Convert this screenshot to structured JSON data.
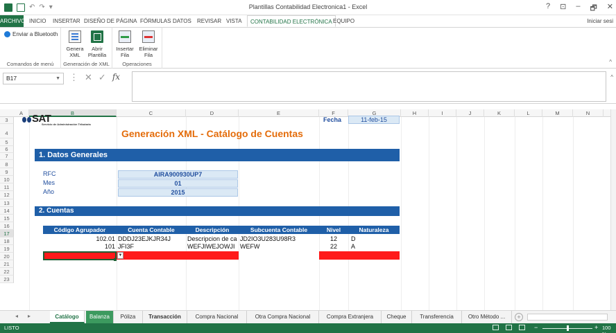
{
  "window": {
    "title": "Plantillas Contabilidad Electronica1 - Excel",
    "controls": [
      "?",
      "⊡",
      "–",
      "🗗",
      "✕"
    ]
  },
  "tabs": [
    "ARCHIVO",
    "INICIO",
    "INSERTAR",
    "DISEÑO DE PÁGINA",
    "FÓRMULAS",
    "DATOS",
    "REVISAR",
    "VISTA",
    "CONTABILIDAD ELECTRÓNICA",
    "EQUIPO"
  ],
  "active_tab": "CONTABILIDAD ELECTRÓNICA",
  "signin": "Iniciar sesi",
  "ribbon": {
    "groups": [
      {
        "label": "Comandos de menú",
        "buttons": [
          "Enviar a Bluetooth"
        ]
      },
      {
        "label": "Generación de XML",
        "buttons": [
          "Genera XML",
          "Abrir Plantilla"
        ]
      },
      {
        "label": "Operaciones",
        "buttons": [
          "Insertar Fila",
          "Eliminar Fila"
        ]
      }
    ],
    "genera_1": "Genera",
    "genera_2": "XML",
    "abrir_1": "Abrir",
    "abrir_2": "Plantilla",
    "insertar_1": "Insertar",
    "insertar_2": "Fila",
    "eliminar_1": "Eliminar",
    "eliminar_2": "Fila"
  },
  "formula_bar": {
    "name_box": "B17",
    "formula": ""
  },
  "columns": [
    "A",
    "B",
    "C",
    "D",
    "E",
    "F",
    "G",
    "H",
    "I",
    "J",
    "K",
    "L",
    "M",
    "N"
  ],
  "selected_column": "B",
  "rows": [
    "3",
    "4",
    "5",
    "6",
    "7",
    "8",
    "9",
    "10",
    "11",
    "12",
    "13",
    "14",
    "15",
    "16",
    "17",
    "18",
    "19",
    "20",
    "21",
    "22",
    "23"
  ],
  "selected_row": "17",
  "sheet": {
    "logo": "SAT",
    "logo_sub": "Servicio de Administración Tributaria",
    "fecha_label": "Fecha",
    "fecha_value": "11-feb-15",
    "title": "Generación XML - Catálogo de Cuentas",
    "section1": "1. Datos Generales",
    "general": [
      {
        "label": "RFC",
        "value": "AIRA900930UP7"
      },
      {
        "label": "Mes",
        "value": "01"
      },
      {
        "label": "Año",
        "value": "2015"
      }
    ],
    "section2": "2. Cuentas",
    "headers": [
      "Código Agrupador",
      "Cuenta Contable",
      "Descripción",
      "Subcuenta Contable",
      "Nivel",
      "Naturaleza"
    ],
    "rows": [
      {
        "codigo": "102.01",
        "cuenta": "DDDJ23EJKJR34J",
        "descripcion": "Descripcion de ca",
        "subcuenta": "JD2IO3U283U98R3",
        "nivel": "12",
        "naturaleza": "D"
      },
      {
        "codigo": "101",
        "cuenta": "JFI3F",
        "descripcion": "WEFJIWEJOWJI",
        "subcuenta": "WEFW",
        "nivel": "22",
        "naturaleza": "A"
      }
    ]
  },
  "sheet_tabs": [
    "Catálogo",
    "Balanza",
    "Póliza",
    "Transacción",
    "Compra Nacional",
    "Otra Compra Nacional",
    "Compra Extranjera",
    "Cheque",
    "Transferencia",
    "Otro Método ..."
  ],
  "active_sheet": "Catálogo",
  "status": {
    "text": "LISTO",
    "zoom": "100 %"
  },
  "colors": {
    "excel_green": "#217346",
    "band_blue": "#1f5fa8",
    "title_orange": "#e46c0a",
    "input_fill": "#dbe9f5",
    "required_red": "#ff1a1a"
  }
}
